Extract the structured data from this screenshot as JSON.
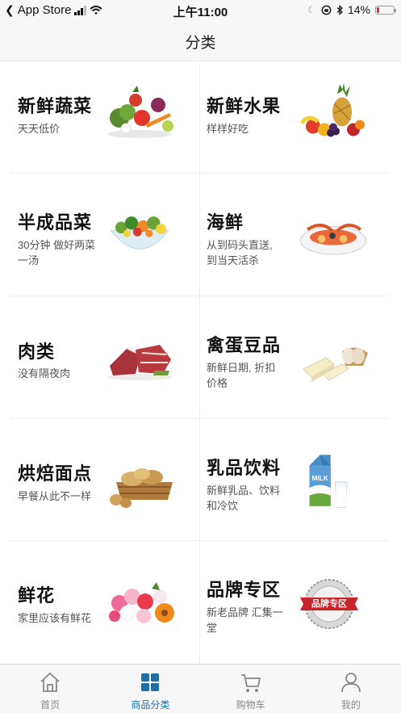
{
  "status_bar": {
    "back_app": "App Store",
    "time": "上午11:00",
    "battery_percent": "14%",
    "battery_level": 0.14,
    "battery_color": "#e0302a"
  },
  "nav": {
    "title": "分类"
  },
  "categories": [
    {
      "title": "新鲜蔬菜",
      "subtitle": "天天低价",
      "icon": "vegetables-image"
    },
    {
      "title": "新鲜水果",
      "subtitle": "样样好吃",
      "icon": "fruits-image"
    },
    {
      "title": "半成品菜",
      "subtitle_lines": [
        "30分钟 做好两菜",
        "一汤"
      ],
      "icon": "salad-bowl-image"
    },
    {
      "title": "海鲜",
      "subtitle_lines": [
        "从到码头直送,",
        "到当天活杀"
      ],
      "icon": "seafood-platter-image"
    },
    {
      "title": "肉类",
      "subtitle": "没有隔夜肉",
      "icon": "meat-image"
    },
    {
      "title": "禽蛋豆品",
      "subtitle_lines": [
        "新鲜日期, 折扣",
        "价格"
      ],
      "icon": "eggs-tofu-image"
    },
    {
      "title": "烘焙面点",
      "subtitle": "早餐从此不一样",
      "icon": "bread-basket-image"
    },
    {
      "title": "乳品饮料",
      "subtitle_lines": [
        "新鲜乳品、饮料",
        "和冷饮"
      ],
      "icon": "milk-carton-image"
    },
    {
      "title": "鲜花",
      "subtitle": "家里应该有鲜花",
      "icon": "flower-bouquet-image"
    },
    {
      "title": "品牌专区",
      "subtitle_lines": [
        "新老品牌 汇集一",
        "堂"
      ],
      "icon": "brand-badge-image",
      "badge_text": "品牌专区"
    }
  ],
  "tabs": [
    {
      "label": "首页",
      "icon": "home-icon",
      "active": false
    },
    {
      "label": "商品分类",
      "icon": "category-grid-icon",
      "active": true
    },
    {
      "label": "购物车",
      "icon": "cart-icon",
      "active": false
    },
    {
      "label": "我的",
      "icon": "user-icon",
      "active": false
    }
  ],
  "colors": {
    "accent": "#1f6fa8",
    "divider": "#eeeeee",
    "bar_bg": "#f7f7f7"
  }
}
